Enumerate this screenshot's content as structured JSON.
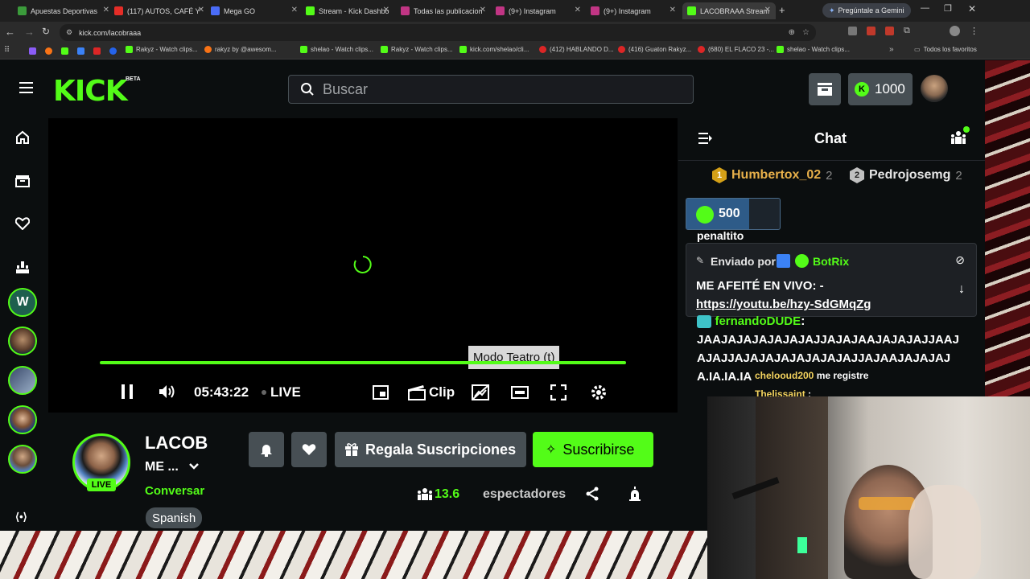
{
  "browser": {
    "tabs": [
      {
        "label": "Apuestas Deportivas",
        "color": "#3b9b3b"
      },
      {
        "label": "(117) AUTOS, CAFÉ Y",
        "color": "#e52d27"
      },
      {
        "label": "Mega GO",
        "color": "#4a6cf7"
      },
      {
        "label": "Stream - Kick Dashbo",
        "color": "#53fc18"
      },
      {
        "label": "Todas las publicacion",
        "color": "#c13584"
      },
      {
        "label": "(9+) Instagram",
        "color": "#c13584"
      },
      {
        "label": "(9+) Instagram",
        "color": "#c13584"
      },
      {
        "label": "LACOBRAAA Stream",
        "color": "#53fc18"
      }
    ],
    "gemini_button": "Pregúntale a Gemini",
    "url": "kick.com/lacobraaa",
    "bookmarks": [
      "Rakyz - Watch clips...",
      "rakyz by @awesom...",
      "shelao - Watch clips...",
      "Rakyz - Watch clips...",
      "kick.com/shelao/cli...",
      "(412) HABLANDO D...",
      "(416) Guaton Rakyz...",
      "(680) EL FLACO 23 -...",
      "shelao - Watch clips..."
    ],
    "all_bookmarks": "Todos los favoritos"
  },
  "header": {
    "logo": "KICK",
    "logo_badge": "BETA",
    "search_placeholder": "Buscar",
    "kicks_count": "1000"
  },
  "player": {
    "time": "05:43:22",
    "live": "LIVE",
    "clip": "Clip",
    "tooltip": "Modo Teatro (t)"
  },
  "channel": {
    "name": "LACOB",
    "title": "ME ...",
    "category": "Conversar",
    "live_badge": "LIVE",
    "language": "Spanish",
    "gift_button": "Regala Suscripciones",
    "subscribe_button": "Suscribirse",
    "viewers": "13.6",
    "viewers_label": "espectadores"
  },
  "chat": {
    "title": "Chat",
    "leaderboard": [
      {
        "rank": "1",
        "name": "Humbertox_02",
        "count": "2"
      },
      {
        "rank": "2",
        "name": "Pedrojosemg",
        "count": "2"
      }
    ],
    "gift_amount": "500",
    "partial_text": "penaltito",
    "pinned_by": "Enviado por",
    "pinned_user": "BotRix",
    "pinned_line1": "ME AFEITÉ EN VIVO: -",
    "pinned_link": "https://youtu.be/hzy-SdGMqZg",
    "msg_user": "fernandoDUDE",
    "msg_text": "JAAJAJAJAJAJAJAJJAJAJAAJAJAJAJJAAJAJAJJAJAJAJAJAJAJAJAJJAJAAJAJAJAJA.IA.IA.IA",
    "overlay_user1": "chelooud200",
    "overlay_msg1": "me registre",
    "overlay_user2": "Thelissaint"
  }
}
